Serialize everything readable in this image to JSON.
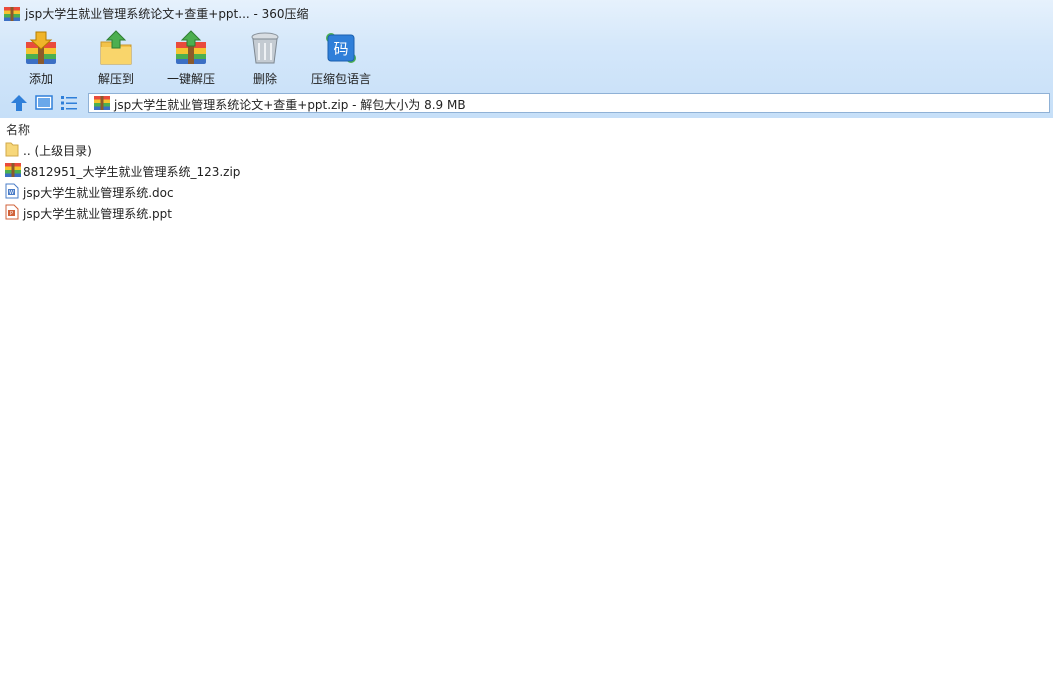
{
  "window": {
    "title": "jsp大学生就业管理系统论文+查重+ppt... - 360压缩"
  },
  "toolbar": {
    "add_label": "添加",
    "extract_to_label": "解压到",
    "one_click_extract_label": "一键解压",
    "delete_label": "删除",
    "archive_language_label": "压缩包语言",
    "archive_language_icon_glyph": "码"
  },
  "address": {
    "path": "jsp大学生就业管理系统论文+查重+ppt.zip - 解包大小为 8.9 MB"
  },
  "file_list": {
    "column_name": "名称",
    "items": [
      {
        "name": ".. (上级目录)",
        "icon": "folder-icon"
      },
      {
        "name": "8812951_大学生就业管理系统_123.zip",
        "icon": "zip-archive-icon"
      },
      {
        "name": "jsp大学生就业管理系统.doc",
        "icon": "word-doc-icon"
      },
      {
        "name": "jsp大学生就业管理系统.ppt",
        "icon": "ppt-icon"
      }
    ]
  },
  "colors": {
    "chrome_top": "#e6f1fc",
    "chrome_bottom": "#c6dff8",
    "address_border": "#8fb1d6",
    "nav_blue": "#2f7fd9"
  }
}
